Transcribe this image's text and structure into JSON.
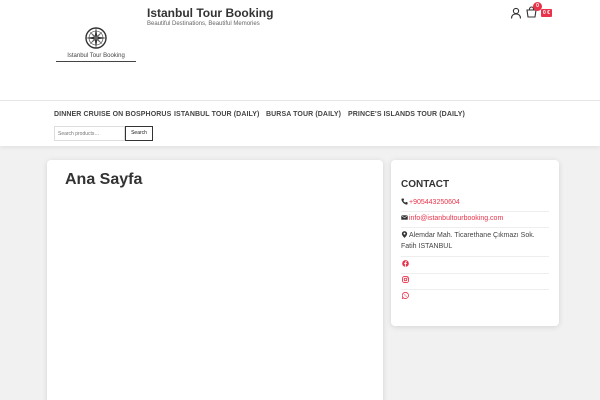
{
  "header": {
    "site_title": "Istanbul Tour Booking",
    "tagline": "Beautiful Destinations, Beautiful Memories",
    "logo_text": "Istanbul Tour Booking",
    "cart_count": "0",
    "cart_total": "0 €"
  },
  "nav": {
    "items": [
      {
        "label": "DINNER CRUISE ON BOSPHORUS"
      },
      {
        "label": "ISTANBUL TOUR (DAILY)"
      },
      {
        "label": "BURSA TOUR (DAILY)"
      },
      {
        "label": "PRINCE'S ISLANDS TOUR (DAILY)"
      }
    ],
    "search_placeholder": "Search products…",
    "search_button": "Search"
  },
  "main": {
    "title": "Ana Sayfa"
  },
  "sidebar": {
    "title": "CONTACT",
    "phone": "+905443250604",
    "email": "info@istanbultourbooking.com",
    "address_line1": "Alemdar Mah. Ticarethane Çıkmazı Sok.",
    "address_line2": "Fatih ISTANBUL",
    "social": [
      "facebook-icon",
      "instagram-icon",
      "whatsapp-icon"
    ]
  },
  "colors": {
    "accent": "#e8334a",
    "background": "#f1f1f1"
  }
}
